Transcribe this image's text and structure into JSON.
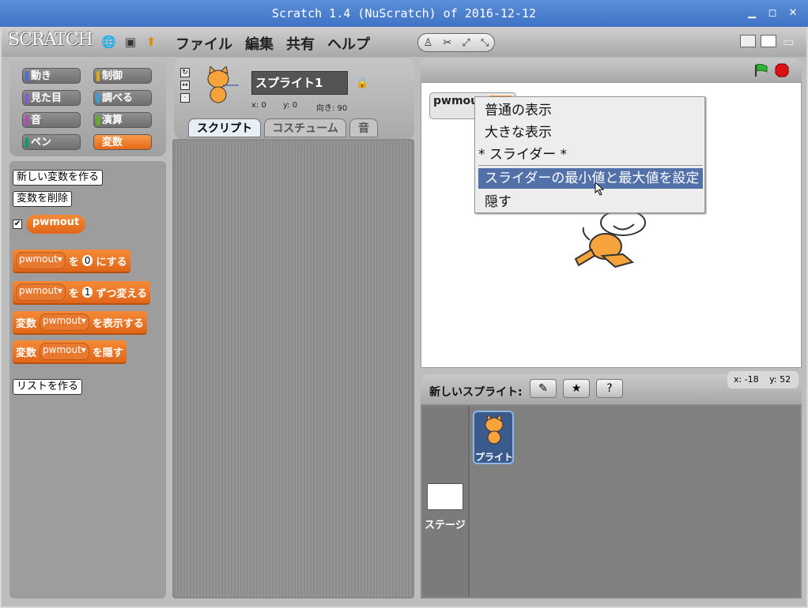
{
  "window": {
    "title": "Scratch 1.4 (NuScratch) of 2016-12-12",
    "min": "▁",
    "max": "◻",
    "close": "✕"
  },
  "logo": "SCRATCH",
  "menu": [
    "ファイル",
    "編集",
    "共有",
    "ヘルプ"
  ],
  "categories": [
    {
      "label": "動き",
      "color": "#4a6cd4"
    },
    {
      "label": "制御",
      "color": "#e1a91a"
    },
    {
      "label": "見た目",
      "color": "#8a55d7"
    },
    {
      "label": "調べる",
      "color": "#2ca5e2"
    },
    {
      "label": "音",
      "color": "#bb42c3"
    },
    {
      "label": "演算",
      "color": "#5cb712"
    },
    {
      "label": "ペン",
      "color": "#0e9a6c"
    },
    {
      "label": "変数",
      "color": "#ee7d16"
    }
  ],
  "palette": {
    "make_var": "新しい変数を作る",
    "delete_var": "変数を削除",
    "var_name": "pwmout",
    "set_block": {
      "var": "pwmout",
      "to": "を",
      "value": "0",
      "suffix": "にする"
    },
    "change_block": {
      "var": "pwmout",
      "by": "を",
      "value": "1",
      "suffix": "ずつ変える"
    },
    "show_block": {
      "prefix": "変数",
      "var": "pwmout",
      "suffix": "を表示する"
    },
    "hide_block": {
      "prefix": "変数",
      "var": "pwmout",
      "suffix": "を隠す"
    },
    "make_list": "リストを作る"
  },
  "sprite": {
    "name": "スプライト1",
    "x_label": "x: 0",
    "y_label": "y: 0",
    "dir_label": "向き: 90",
    "tabs": [
      "スクリプト",
      "コスチューム",
      "音"
    ]
  },
  "stage": {
    "watcher_label": "pwmout",
    "context_menu": [
      "普通の表示",
      "大きな表示",
      "* スライダー *",
      "スライダーの最小値と最大値を設定",
      "隠す"
    ],
    "mouse_x": "x: -18",
    "mouse_y": "y: 52"
  },
  "sprites_panel": {
    "new_sprite_label": "新しいスプライト:",
    "stage_label": "ステージ",
    "sprite_label": "プライト"
  }
}
